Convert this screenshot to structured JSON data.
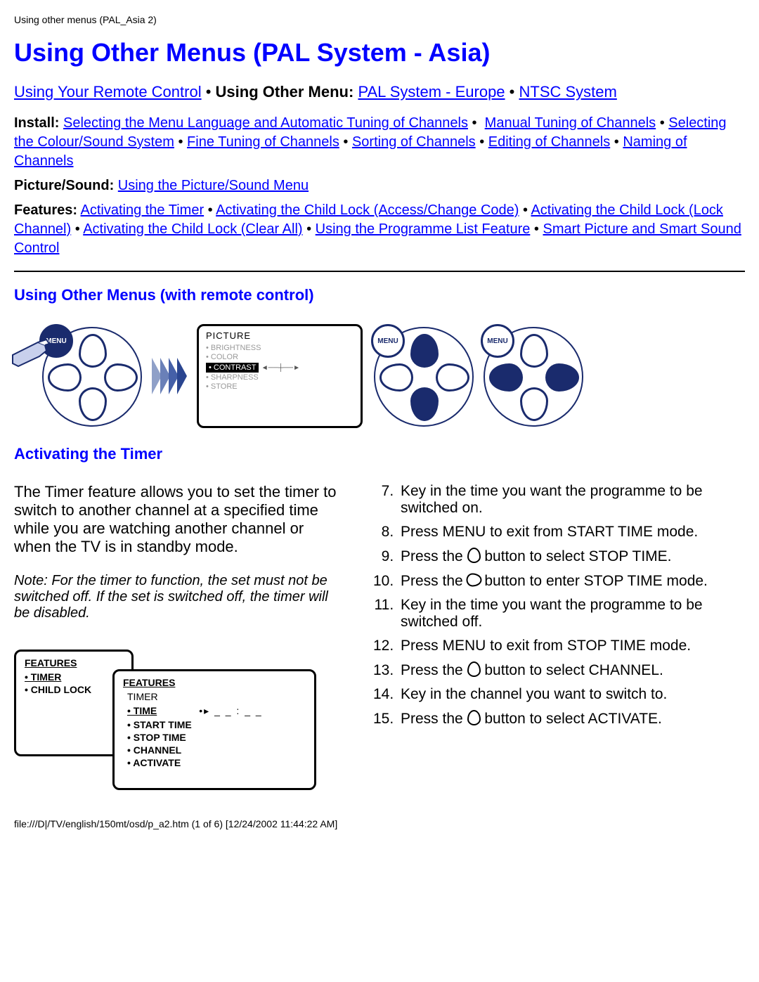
{
  "header_path": "Using other menus (PAL_Asia 2)",
  "title": "Using Other Menus (PAL System - Asia)",
  "nav_top": {
    "remote": "Using Your Remote Control",
    "sep": " • ",
    "using_other_bold": "Using Other Menu:",
    "pal_europe": "PAL System - Europe",
    "ntsc": "NTSC System"
  },
  "nav_sub": {
    "install_label": "Install:",
    "install_links": [
      "Selecting the Menu Language and Automatic Tuning of Channels",
      "Manual Tuning of Channels",
      "Selecting the Colour/Sound System",
      "Fine Tuning of Channels",
      "Sorting of Channels",
      "Editing of Channels",
      "Naming of Channels"
    ],
    "picsound_label": "Picture/Sound:",
    "picsound_link": "Using the Picture/Sound Menu",
    "features_label": "Features:",
    "features_links": [
      "Activating the Timer",
      "Activating the Child Lock (Access/Change Code)",
      "Activating the Child Lock (Lock Channel)",
      "Activating the Child Lock (Clear All)",
      "Using the Programme List Feature",
      "Smart Picture and Smart Sound Control"
    ]
  },
  "section_remote": "Using Other Menus (with remote control)",
  "osd": {
    "title": "PICTURE",
    "items": [
      "• BRIGHTNESS",
      "• COLOR"
    ],
    "highlight": "• CONTRAST",
    "items2": [
      "• SHARPNESS",
      "• STORE"
    ]
  },
  "menu_label": "MENU",
  "section_timer": "Activating the Timer",
  "timer_intro": "The Timer feature allows you to set the timer to switch to another channel at a specified time while you are watching another channel or when the TV is in standby mode.",
  "timer_note": "Note: For the timer to function, the set must not be switched off. If the set is switched off, the timer will be disabled.",
  "panel1": {
    "title": "FEATURES",
    "item1": "• TIMER",
    "item2": "• CHILD LOCK"
  },
  "panel2": {
    "title": "FEATURES",
    "sub": "TIMER",
    "items": [
      "• TIME",
      "• START TIME",
      "• STOP TIME",
      "• CHANNEL",
      "• ACTIVATE"
    ],
    "time_display": "_ _ : _ _"
  },
  "steps": {
    "s7": "Key in the time you want the programme to be switched on.",
    "s8": "Press MENU to exit from START TIME mode.",
    "s9a": "Press the ",
    "s9b": " button to select STOP TIME.",
    "s10a": "Press the ",
    "s10b": " button to enter STOP TIME mode.",
    "s11": "Key in the time you want the programme to be switched off.",
    "s12": "Press MENU to exit from STOP TIME mode.",
    "s13a": "Press the ",
    "s13b": " button to select CHANNEL.",
    "s14": "Key in the channel you want to switch to.",
    "s15a": "Press the ",
    "s15b": " button to select ACTIVATE."
  },
  "footer_path": "file:///D|/TV/english/150mt/osd/p_a2.htm (1 of 6) [12/24/2002 11:44:22 AM]"
}
